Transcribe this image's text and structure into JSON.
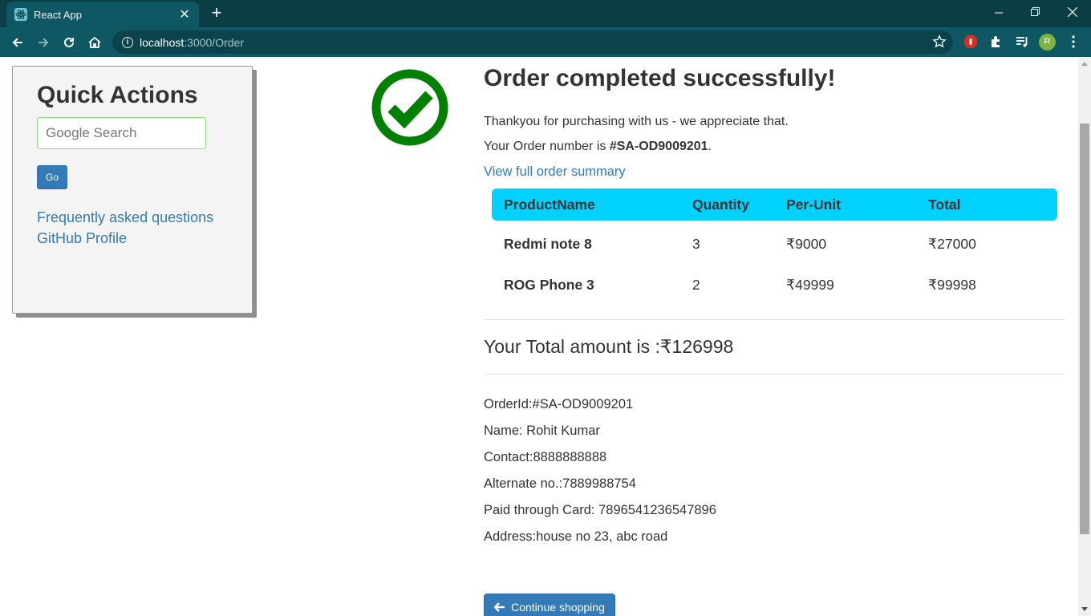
{
  "browser": {
    "tab_title": "React App",
    "url_host": "localhost",
    "url_path": ":3000/Order",
    "profile_initial": "R",
    "accent": "#0f5763"
  },
  "quick_actions": {
    "title": "Quick Actions",
    "search_placeholder": "Google Search",
    "go_label": "Go",
    "links": [
      "Frequently asked questions",
      "GitHub Profile"
    ]
  },
  "order": {
    "heading": "Order completed successfully!",
    "thank_you": "Thankyou for purchasing with us - we appreciate that.",
    "order_number_prefix": "Your Order number is ",
    "order_number": "#SA-OD9009201",
    "order_number_suffix": ".",
    "summary_link": "View full order summary",
    "table": {
      "headers": [
        "ProductName",
        "Quantity",
        "Per-Unit",
        "Total"
      ],
      "rows": [
        [
          "Redmi note 8",
          "3",
          "₹9000",
          "₹27000"
        ],
        [
          "ROG Phone 3",
          "2",
          "₹49999",
          "₹99998"
        ]
      ]
    },
    "total_line": "Your Total amount is :₹126998",
    "details": [
      "OrderId:#SA-OD9009201",
      "Name: Rohit Kumar",
      "Contact:8888888888",
      "Alternate no.:7889988754",
      "Paid through Card: 7896541236547896",
      "Address:house no 23, abc road"
    ],
    "continue_label": "Continue shopping",
    "success_color": "#008000",
    "header_color": "#00d1ff"
  }
}
